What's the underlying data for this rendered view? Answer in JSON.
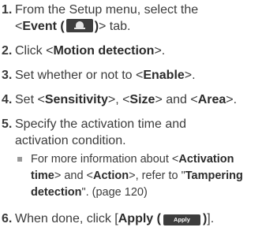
{
  "steps": [
    {
      "number": "1.",
      "line1": "From the Setup menu, select the",
      "line2_prefix": "<",
      "line2_bold": "Event (",
      "line2_icon": "bell-icon",
      "line2_bold_close": ")",
      "line2_suffix": "> tab."
    },
    {
      "number": "2.",
      "prefix": "Click <",
      "bold": "Motion detection",
      "suffix": ">."
    },
    {
      "number": "3.",
      "prefix": "Set whether or not to <",
      "bold": "Enable",
      "suffix": ">."
    },
    {
      "number": "4.",
      "prefix": "Set <",
      "bold1": "Sensitivity",
      "mid1": ">, <",
      "bold2": "Size",
      "mid2": "> and <",
      "bold3": "Area",
      "suffix": ">."
    },
    {
      "number": "5.",
      "line1": "Specify the activation time and",
      "line2": "activation condition."
    },
    {
      "number": "6.",
      "prefix": "When done, click [",
      "bold": "Apply (",
      "button_label": "Apply",
      "bold_close": ")",
      "suffix": "]."
    }
  ],
  "note": {
    "l1_a": "For more information about <",
    "l1_b": "Activation",
    "l2_a": "time",
    "l2_b": "> and <",
    "l2_c": "Action",
    "l2_d": ">, refer to \"",
    "l2_e": "Tampering",
    "l3_a": "detection",
    "l3_b": "\". (page 120)"
  }
}
